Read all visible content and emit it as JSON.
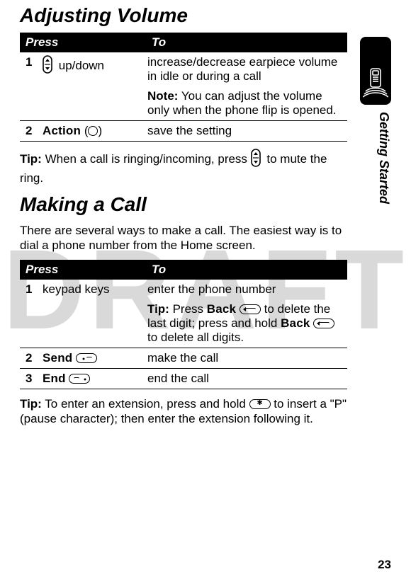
{
  "watermark": "DRAFT",
  "sideTab": {
    "label": "Getting Started"
  },
  "pageNumber": "23",
  "section1": {
    "title": "Adjusting Volume",
    "table": {
      "headers": {
        "press": "Press",
        "to": "To"
      },
      "row1": {
        "step": "1",
        "press": "up/down",
        "to_line1": "increase/decrease earpiece volume in idle or during a call",
        "note_label": "Note:",
        "note_text": " You can adjust the volume only when the phone flip is opened."
      },
      "row2": {
        "step": "2",
        "press_label": "Action",
        "press_paren_open": " (",
        "press_paren_close": ")",
        "to": "save the setting"
      }
    },
    "tip": {
      "label": "Tip:",
      "text_before": " When a call is ringing/incoming, press ",
      "text_after": " to mute the ring."
    }
  },
  "section2": {
    "title": "Making a Call",
    "intro": "There are several ways to make a call. The easiest way is to dial a phone number from the Home screen.",
    "table": {
      "headers": {
        "press": "Press",
        "to": "To"
      },
      "row1": {
        "step": "1",
        "press": "keypad keys",
        "to_line1": "enter the phone number",
        "tip_label": "Tip:",
        "tip_mid1": " Press ",
        "back_label": "Back",
        "tip_mid2": " to delete the last digit; press and hold ",
        "tip_mid3": " to delete all digits."
      },
      "row2": {
        "step": "2",
        "press_label": "Send",
        "to": "make the call"
      },
      "row3": {
        "step": "3",
        "press_label": "End",
        "to": "end the call"
      }
    },
    "tip": {
      "label": "Tip:",
      "text_before": " To enter an extension, press and hold ",
      "text_after": " to insert a \"P\" (pause character); then enter the extension following it."
    }
  }
}
